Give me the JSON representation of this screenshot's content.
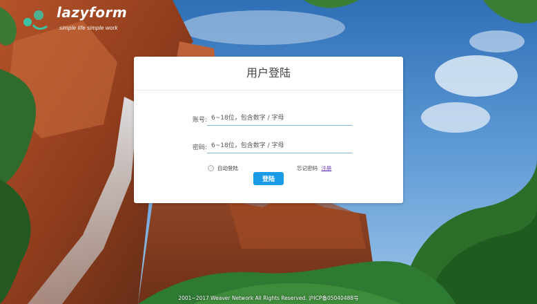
{
  "logo": {
    "name": "lazyform",
    "tagline": "simple life simple work"
  },
  "login": {
    "title": "用户登陆",
    "username_label": "账号:",
    "username_placeholder": "6~18位，包含数字 / 字母",
    "password_label": "密码:",
    "password_placeholder": "6~18位，包含数字 / 字母",
    "remember_label": "自动登陆",
    "forgot_label": "忘记密码",
    "register_label": "注册",
    "submit_label": "登陆"
  },
  "footer": {
    "text": "2001~2017 Weaver Network All Rights Reserved. 沪ICP备05040488号"
  },
  "colors": {
    "accent": "#1a9be8",
    "register_link": "#6b3fb5"
  }
}
